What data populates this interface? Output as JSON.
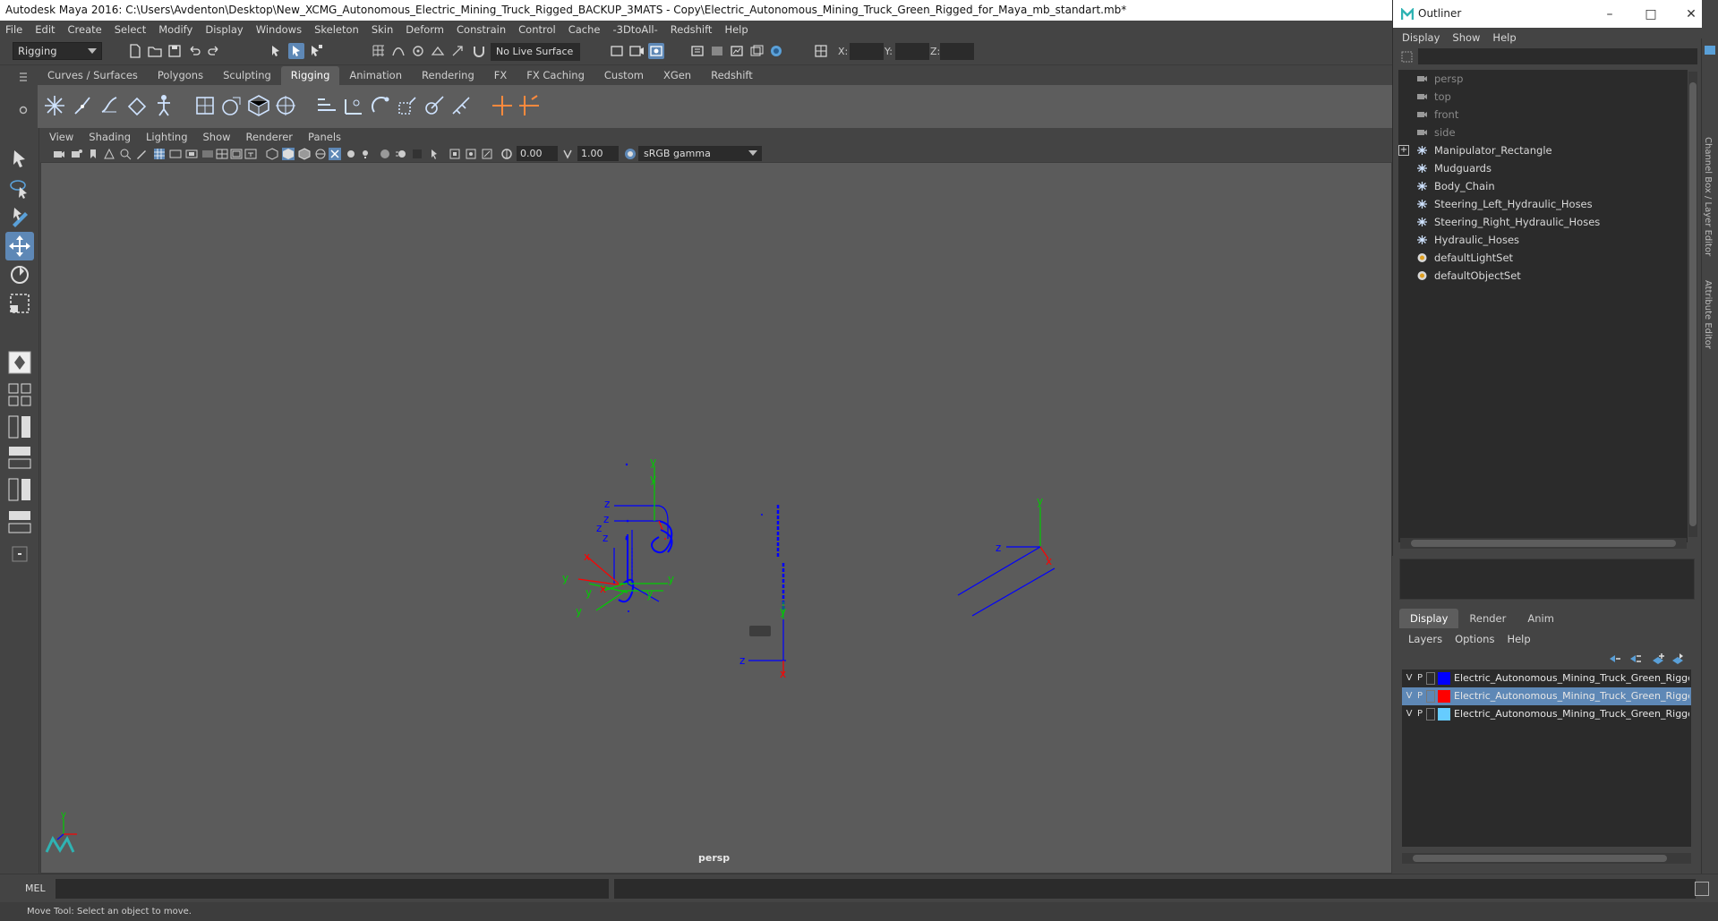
{
  "window": {
    "title": "Autodesk Maya 2016: C:\\Users\\Avdenton\\Desktop\\New_XCMG_Autonomous_Electric_Mining_Truck_Rigged_BACKUP_3MATS - Copy\\Electric_Autonomous_Mining_Truck_Green_Rigged_for_Maya_mb_standart.mb*"
  },
  "menubar": [
    "File",
    "Edit",
    "Create",
    "Select",
    "Modify",
    "Display",
    "Windows",
    "Skeleton",
    "Skin",
    "Deform",
    "Constrain",
    "Control",
    "Cache",
    "-3DtoAll-",
    "Redshift",
    "Help"
  ],
  "statusline": {
    "mode": "Rigging",
    "live_surface": "No Live Surface",
    "x_label": "X:",
    "y_label": "Y:",
    "z_label": "Z:"
  },
  "shelf": {
    "tabs": [
      "Curves / Surfaces",
      "Polygons",
      "Sculpting",
      "Rigging",
      "Animation",
      "Rendering",
      "FX",
      "FX Caching",
      "Custom",
      "XGen",
      "Redshift"
    ],
    "active_tab": "Rigging"
  },
  "panel": {
    "menu": [
      "View",
      "Shading",
      "Lighting",
      "Show",
      "Renderer",
      "Panels"
    ],
    "exposure": "0.00",
    "gamma_value": "1.00",
    "color_space": "sRGB gamma",
    "camera_label": "persp"
  },
  "viewport": {
    "axis_labels": {
      "y": "y",
      "z": "z",
      "x": "x"
    }
  },
  "outliner": {
    "title": "Outliner",
    "menu": [
      "Display",
      "Show",
      "Help"
    ],
    "items": [
      {
        "label": "persp",
        "icon": "camera-icon",
        "dim": true
      },
      {
        "label": "top",
        "icon": "camera-icon",
        "dim": true
      },
      {
        "label": "front",
        "icon": "camera-icon",
        "dim": true
      },
      {
        "label": "side",
        "icon": "camera-icon",
        "dim": true
      },
      {
        "label": "Manipulator_Rectangle",
        "icon": "transform-icon",
        "dim": false,
        "expandable": true
      },
      {
        "label": "Mudguards",
        "icon": "transform-icon",
        "dim": false
      },
      {
        "label": "Body_Chain",
        "icon": "transform-icon",
        "dim": false
      },
      {
        "label": "Steering_Left_Hydraulic_Hoses",
        "icon": "transform-icon",
        "dim": false
      },
      {
        "label": "Steering_Right_Hydraulic_Hoses",
        "icon": "transform-icon",
        "dim": false
      },
      {
        "label": "Hydraulic_Hoses",
        "icon": "transform-icon",
        "dim": false
      },
      {
        "label": "defaultLightSet",
        "icon": "set-icon",
        "dim": false
      },
      {
        "label": "defaultObjectSet",
        "icon": "set-icon",
        "dim": false
      }
    ]
  },
  "side_tabs": [
    "Channel Box / Layer Editor",
    "Attribute Editor"
  ],
  "layer_editor": {
    "tabs": [
      "Display",
      "Render",
      "Anim"
    ],
    "active_tab": "Display",
    "menu": [
      "Layers",
      "Options",
      "Help"
    ],
    "layers": [
      {
        "v": "V",
        "p": "P",
        "color": "#0000ff",
        "name": "Electric_Autonomous_Mining_Truck_Green_Rigged_",
        "selected": false
      },
      {
        "v": "V",
        "p": "P",
        "color": "#ff0000",
        "name": "Electric_Autonomous_Mining_Truck_Green_Rigged_",
        "selected": true
      },
      {
        "v": "V",
        "p": "P",
        "color": "#66ccff",
        "name": "Electric_Autonomous_Mining_Truck_Green_Rigged_",
        "selected": false
      }
    ]
  },
  "cmdline": {
    "label": "MEL"
  },
  "helpline": {
    "text": "Move Tool: Select an object to move."
  },
  "colors": {
    "selection": "#5e88b6",
    "viewport_bg": "#5b5b5b",
    "wire": "#0000ff"
  }
}
